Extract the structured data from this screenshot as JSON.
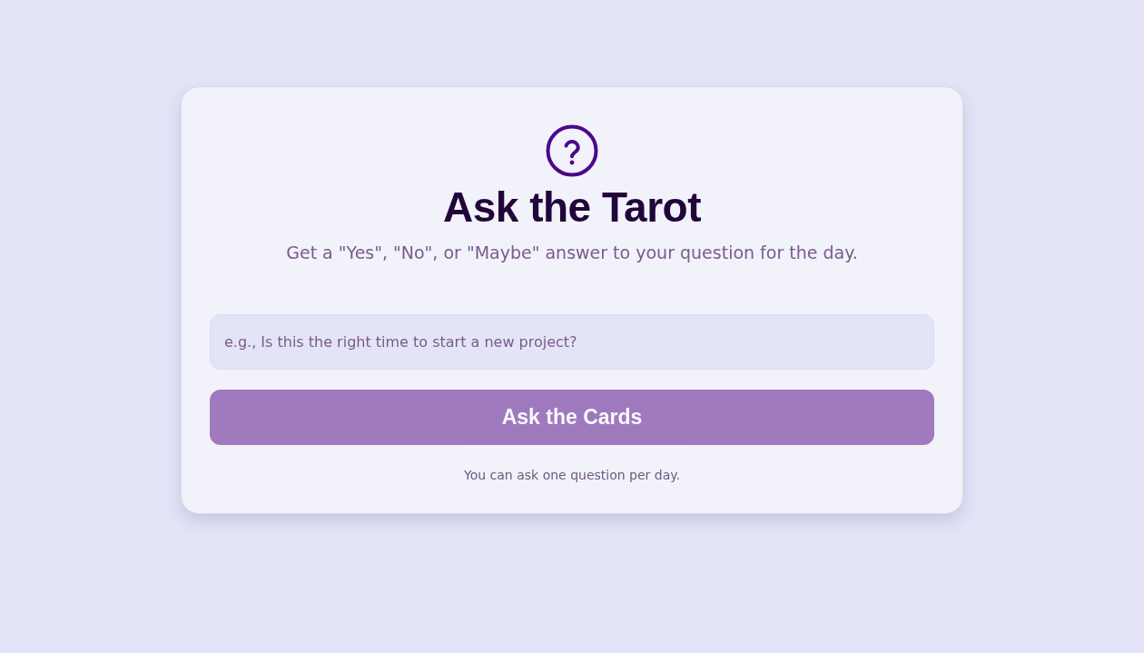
{
  "card": {
    "title": "Ask the Tarot",
    "subtitle": "Get a \"Yes\", \"No\", or \"Maybe\" answer to your question for the day.",
    "question": {
      "placeholder": "e.g., Is this the right time to start a new project?"
    },
    "button": {
      "label": "Ask the Cards",
      "disabled": true
    },
    "note": "You can ask one question per day."
  }
}
